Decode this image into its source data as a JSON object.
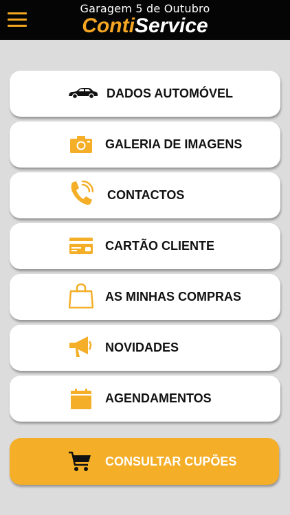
{
  "header": {
    "subtitle": "Garagem 5 de Outubro",
    "brand_part1": "Conti",
    "brand_part2": "Service",
    "menu_icon": "hamburger-menu-icon"
  },
  "menu": [
    {
      "label": "DADOS AUTOMÓVEL",
      "icon": "car-icon"
    },
    {
      "label": "GALERIA DE IMAGENS",
      "icon": "camera-icon"
    },
    {
      "label": "CONTACTOS",
      "icon": "phone-icon"
    },
    {
      "label": "CARTÃO CLIENTE",
      "icon": "card-icon"
    },
    {
      "label": "AS MINHAS COMPRAS",
      "icon": "shopping-bag-icon"
    },
    {
      "label": "NOVIDADES",
      "icon": "megaphone-icon"
    },
    {
      "label": "AGENDAMENTOS",
      "icon": "calendar-icon"
    }
  ],
  "coupon_button": {
    "label": "CONSULTAR CUPÕES",
    "icon": "cart-icon"
  },
  "colors": {
    "accent": "#f4ae27",
    "header_bg": "#050505",
    "page_bg": "#dcdcdc"
  }
}
